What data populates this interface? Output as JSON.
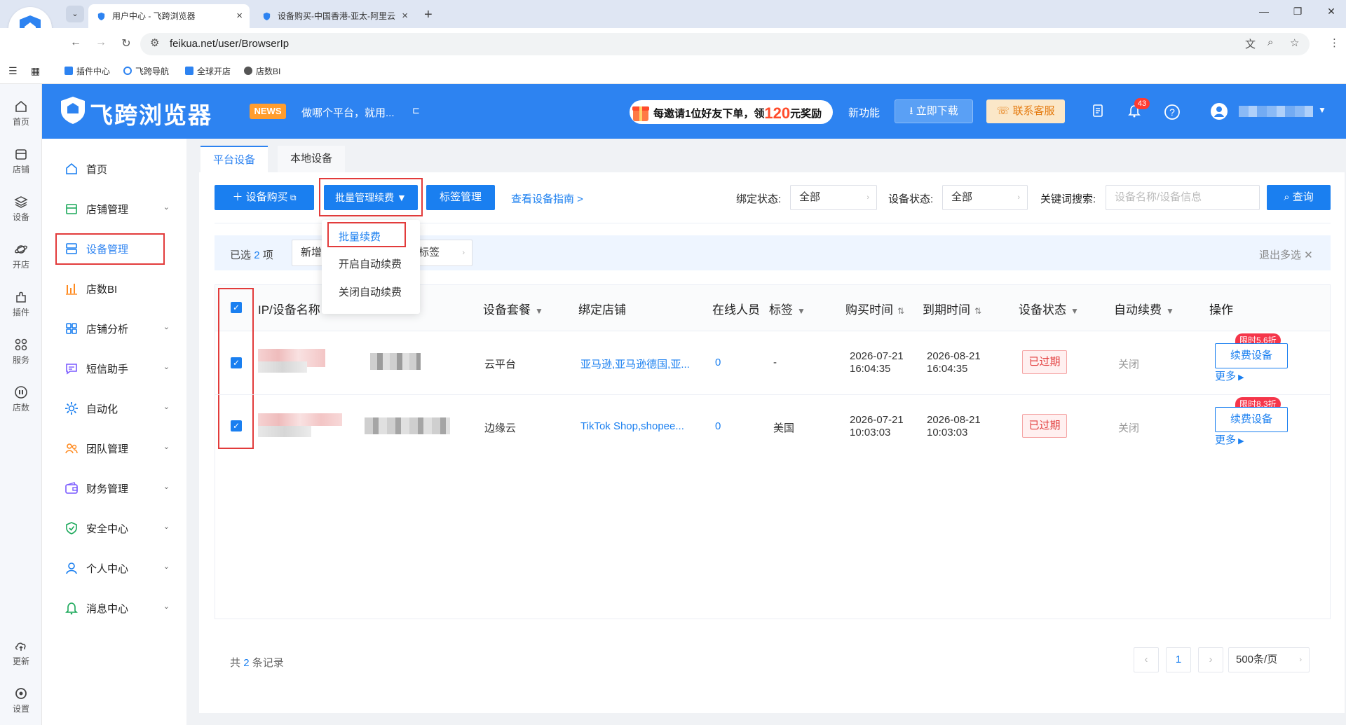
{
  "browser": {
    "tabs": [
      {
        "title": "用户中心 - 飞跨浏览器",
        "active": true
      },
      {
        "title": "设备购买-中国香港-亚太-阿里云",
        "active": false
      }
    ],
    "url": "feikua.net/user/BrowserIp",
    "bookmarks": [
      "插件中心",
      "飞跨导航",
      "全球开店",
      "店数BI"
    ]
  },
  "rail": [
    {
      "label": "首页",
      "icon": "home-icon"
    },
    {
      "label": "店铺",
      "icon": "store-icon"
    },
    {
      "label": "设备",
      "icon": "layers-icon"
    },
    {
      "label": "开店",
      "icon": "planet-icon"
    },
    {
      "label": "插件",
      "icon": "puzzle-icon"
    },
    {
      "label": "服务",
      "icon": "grid-icon"
    },
    {
      "label": "店数",
      "icon": "bi-icon"
    },
    {
      "label": "更新",
      "icon": "cloud-upload-icon"
    },
    {
      "label": "设置",
      "icon": "settings-icon"
    }
  ],
  "header": {
    "brand": "飞跨浏览器",
    "news_tag": "NEWS",
    "news_text": "做哪个平台，就用...",
    "invite_prefix": "每邀请1位好友下单，领",
    "invite_amount": "120",
    "invite_suffix": "元奖励",
    "new_feature": "新功能",
    "download": "立即下载",
    "service": "联系客服",
    "notification_count": "43"
  },
  "menu": [
    {
      "label": "首页",
      "chevron": false
    },
    {
      "label": "店铺管理",
      "chevron": true
    },
    {
      "label": "设备管理",
      "chevron": false,
      "active": true
    },
    {
      "label": "店数BI",
      "chevron": false
    },
    {
      "label": "店铺分析",
      "chevron": true
    },
    {
      "label": "短信助手",
      "chevron": true
    },
    {
      "label": "自动化",
      "chevron": true
    },
    {
      "label": "团队管理",
      "chevron": true
    },
    {
      "label": "财务管理",
      "chevron": true
    },
    {
      "label": "安全中心",
      "chevron": true
    },
    {
      "label": "个人中心",
      "chevron": true
    },
    {
      "label": "消息中心",
      "chevron": true
    }
  ],
  "subtabs": [
    "平台设备",
    "本地设备"
  ],
  "actions": {
    "buy": "设备购买",
    "batch": "批量管理续费",
    "tags": "标签管理",
    "guide": "查看设备指南 >"
  },
  "filters": {
    "bind_label": "绑定状态:",
    "bind_value": "全部",
    "status_label": "设备状态:",
    "status_value": "全部",
    "keyword_label": "关键词搜索:",
    "keyword_placeholder": "设备名称/设备信息",
    "search": "查询"
  },
  "selection": {
    "prefix": "已选",
    "count": "2",
    "suffix": "项",
    "btn_add": "新增",
    "btn_tag": "标签",
    "exit": "退出多选"
  },
  "dropdown": [
    "批量续费",
    "开启自动续费",
    "关闭自动续费"
  ],
  "table": {
    "headers": [
      "IP/设备名称",
      "设备套餐",
      "绑定店铺",
      "在线人员",
      "标签",
      "购买时间",
      "到期时间",
      "设备状态",
      "自动续费",
      "操作"
    ],
    "rows": [
      {
        "package": "云平台",
        "store": "亚马逊,亚马逊德国,亚...",
        "online": "0",
        "tag": "-",
        "buy_date": "2026-07-21",
        "buy_time": "16:04:35",
        "expire_date": "2026-08-21",
        "expire_time": "16:04:35",
        "status": "已过期",
        "auto": "关闭",
        "promo": "限时5.6折",
        "renew": "续费设备",
        "more": "更多"
      },
      {
        "package": "边缘云",
        "store": "TikTok Shop,shopee...",
        "online": "0",
        "tag": "美国",
        "buy_date": "2026-07-21",
        "buy_time": "10:03:03",
        "expire_date": "2026-08-21",
        "expire_time": "10:03:03",
        "status": "已过期",
        "auto": "关闭",
        "promo": "限时8.3折",
        "renew": "续费设备",
        "more": "更多"
      }
    ]
  },
  "pagination": {
    "total_prefix": "共",
    "total_count": "2",
    "total_suffix": "条记录",
    "page": "1",
    "page_size": "500条/页"
  },
  "colors": {
    "primary": "#1a7ff0",
    "header": "#2d83f1",
    "danger": "#e23b3b",
    "promo": "#f5364a"
  }
}
